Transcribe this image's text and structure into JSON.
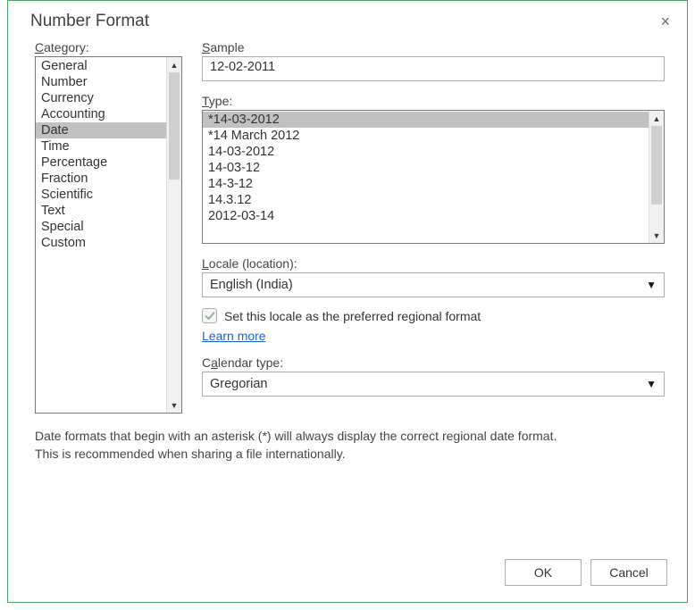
{
  "dialog": {
    "title": "Number Format",
    "close_label": "×"
  },
  "category": {
    "label": "Category:",
    "items": [
      "General",
      "Number",
      "Currency",
      "Accounting",
      "Date",
      "Time",
      "Percentage",
      "Fraction",
      "Scientific",
      "Text",
      "Special",
      "Custom"
    ],
    "selected_index": 4
  },
  "sample": {
    "label": "Sample",
    "value": "12-02-2011"
  },
  "type": {
    "label": "Type:",
    "items": [
      "*14-03-2012",
      "*14 March 2012",
      "14-03-2012",
      "14-03-12",
      "14-3-12",
      "14.3.12",
      "2012-03-14"
    ],
    "selected_index": 0
  },
  "locale": {
    "label": "Locale (location):",
    "value": "English (India)"
  },
  "pref": {
    "checkbox_label": "Set this locale as the preferred regional format",
    "checked": true,
    "learn_more": "Learn more"
  },
  "calendar": {
    "label": "Calendar type:",
    "value": "Gregorian"
  },
  "help": {
    "line1": "Date formats that begin with an asterisk (*) will always display the correct regional date format.",
    "line2": "This is recommended when sharing a file internationally."
  },
  "buttons": {
    "ok": "OK",
    "cancel": "Cancel"
  }
}
